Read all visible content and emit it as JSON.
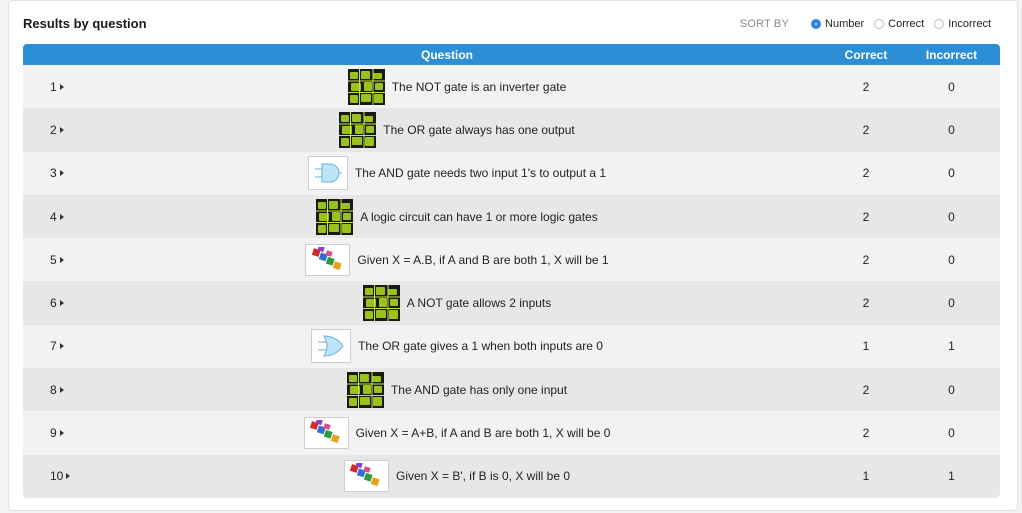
{
  "header": {
    "title": "Results by question",
    "sort_by_label": "SORT BY",
    "sort_options": [
      {
        "label": "Number",
        "checked": true
      },
      {
        "label": "Correct",
        "checked": false
      },
      {
        "label": "Incorrect",
        "checked": false
      }
    ]
  },
  "table": {
    "columns": {
      "question": "Question",
      "correct": "Correct",
      "incorrect": "Incorrect"
    },
    "rows": [
      {
        "number": "1",
        "image": "circuit-board",
        "question": "The NOT gate is an inverter gate",
        "correct": "2",
        "incorrect": "0"
      },
      {
        "number": "2",
        "image": "circuit-board",
        "question": "The OR gate always has one output",
        "correct": "2",
        "incorrect": "0"
      },
      {
        "number": "3",
        "image": "and-gate-symbol",
        "question": "The AND gate needs two input 1's to output a 1",
        "correct": "2",
        "incorrect": "0"
      },
      {
        "number": "4",
        "image": "circuit-board",
        "question": "A logic circuit can have 1 or more logic gates",
        "correct": "2",
        "incorrect": "0"
      },
      {
        "number": "5",
        "image": "logic-blocks",
        "question": "Given X = A.B, if A and B are both 1, X will be 1",
        "correct": "2",
        "incorrect": "0"
      },
      {
        "number": "6",
        "image": "circuit-board",
        "question": "A NOT gate allows 2 inputs",
        "correct": "2",
        "incorrect": "0"
      },
      {
        "number": "7",
        "image": "or-gate-symbol",
        "question": "The OR gate gives a 1 when both inputs are 0",
        "correct": "1",
        "incorrect": "1"
      },
      {
        "number": "8",
        "image": "circuit-board",
        "question": "The AND gate has only one input",
        "correct": "2",
        "incorrect": "0"
      },
      {
        "number": "9",
        "image": "logic-blocks",
        "question": "Given X = A+B, if A and B are both 1, X will be 0",
        "correct": "2",
        "incorrect": "0"
      },
      {
        "number": "10",
        "image": "logic-blocks",
        "question": "Given X = B', if B is 0, X will be 0",
        "correct": "1",
        "incorrect": "1"
      }
    ]
  },
  "colors": {
    "header_bg": "#2c8fd6",
    "accent": "#2f86de",
    "row_light": "#f2f2f2",
    "row_dark": "#e7e7e7"
  }
}
